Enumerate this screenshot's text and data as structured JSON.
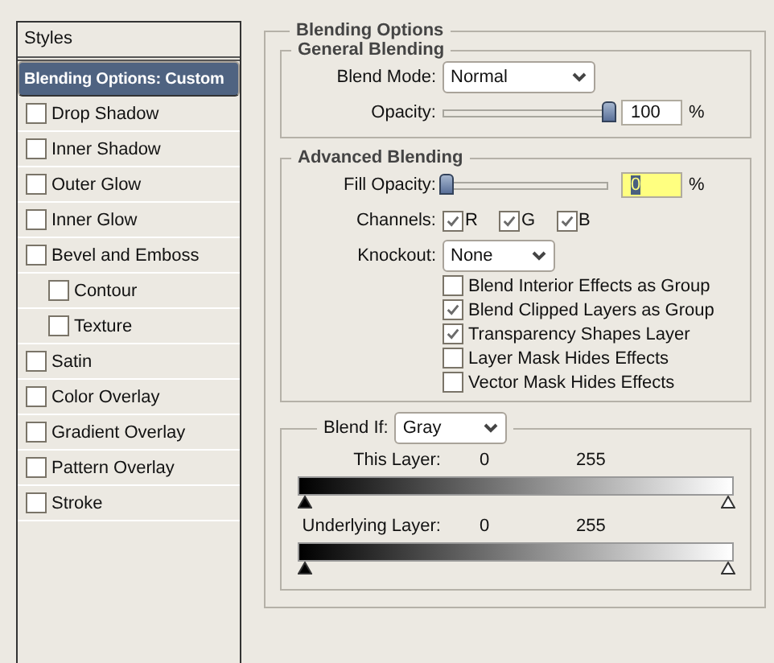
{
  "sidebar": {
    "header": "Styles",
    "items": [
      {
        "label": "Blending Options: Custom",
        "kind": "plain",
        "selected": true
      },
      {
        "label": "Drop Shadow",
        "kind": "check",
        "selected": false,
        "checked": false
      },
      {
        "label": "Inner Shadow",
        "kind": "check",
        "selected": false,
        "checked": false
      },
      {
        "label": "Outer Glow",
        "kind": "check",
        "selected": false,
        "checked": false
      },
      {
        "label": "Inner Glow",
        "kind": "check",
        "selected": false,
        "checked": false
      },
      {
        "label": "Bevel and Emboss",
        "kind": "check",
        "selected": false,
        "checked": false,
        "children": [
          {
            "label": "Contour",
            "kind": "check",
            "selected": false,
            "checked": false
          },
          {
            "label": "Texture",
            "kind": "check",
            "selected": false,
            "checked": false
          }
        ]
      },
      {
        "label": "Satin",
        "kind": "check",
        "selected": false,
        "checked": false
      },
      {
        "label": "Color Overlay",
        "kind": "check",
        "selected": false,
        "checked": false
      },
      {
        "label": "Gradient Overlay",
        "kind": "check",
        "selected": false,
        "checked": false
      },
      {
        "label": "Pattern Overlay",
        "kind": "check",
        "selected": false,
        "checked": false
      },
      {
        "label": "Stroke",
        "kind": "check",
        "selected": false,
        "checked": false
      }
    ]
  },
  "blending_options": {
    "title": "Blending Options",
    "general": {
      "title": "General Blending",
      "blend_mode_label": "Blend Mode:",
      "blend_mode": "Normal",
      "opacity_label": "Opacity:",
      "opacity": {
        "level": 1,
        "value": "100",
        "unit": "%"
      }
    },
    "advanced": {
      "title": "Advanced Blending",
      "fill_opacity_label": "Fill Opacity:",
      "fill_opacity": {
        "level": 0,
        "value": "0",
        "unit": "%",
        "selected": true
      },
      "channels_label": "Channels:",
      "channels": [
        {
          "label": "R",
          "checked": true
        },
        {
          "label": "G",
          "checked": true
        },
        {
          "label": "B",
          "checked": true
        }
      ],
      "knockout_label": "Knockout:",
      "knockout": "None",
      "options": [
        {
          "label": "Blend Interior Effects as Group",
          "checked": false
        },
        {
          "label": "Blend Clipped Layers as Group",
          "checked": true
        },
        {
          "label": "Transparency Shapes Layer",
          "checked": true
        },
        {
          "label": "Layer Mask Hides Effects",
          "checked": false
        },
        {
          "label": "Vector Mask Hides Effects",
          "checked": false
        }
      ]
    },
    "blend_if": {
      "label": "Blend If:",
      "value": "Gray",
      "layers": [
        {
          "label": "This Layer:",
          "low": "0",
          "high": "255",
          "thumbs": [
            {
              "level": 0
            },
            {
              "level": 1
            }
          ]
        },
        {
          "label": "Underlying Layer:",
          "low": "0",
          "high": "255",
          "thumbs": [
            {
              "level": 0
            },
            {
              "level": 1
            }
          ]
        }
      ]
    }
  }
}
